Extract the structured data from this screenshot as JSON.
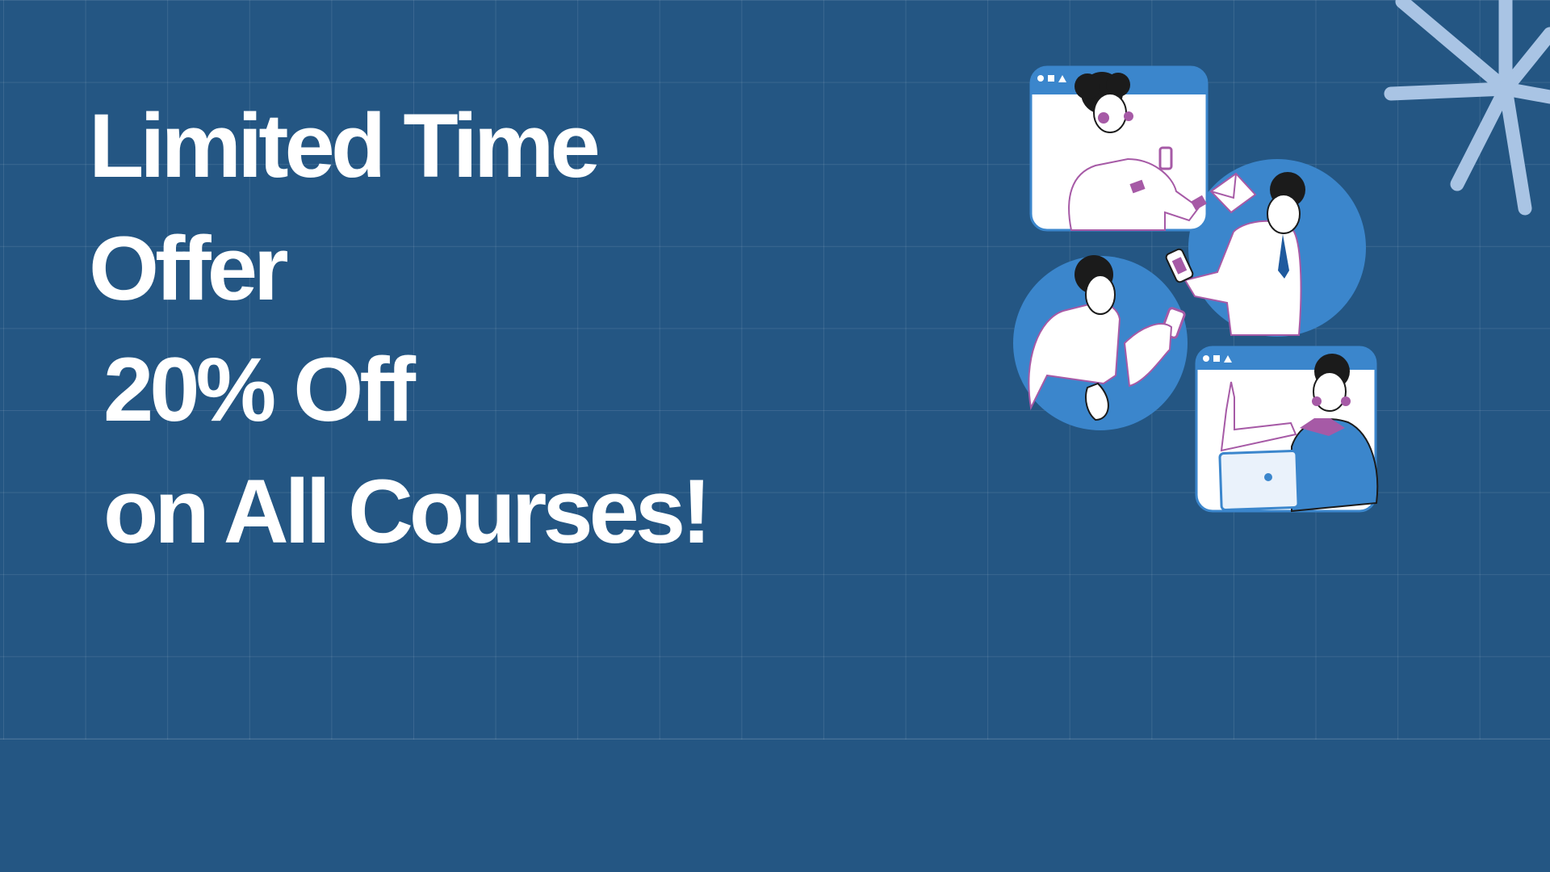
{
  "promo": {
    "line1": "Limited Time",
    "line2": "Offer",
    "line3": "20% Off",
    "line4": "on All Courses!"
  },
  "colors": {
    "background": "#245683",
    "text": "#ffffff",
    "accent_blue": "#3b86cc",
    "accent_purple": "#a65aa6",
    "star": "#a9c4e4"
  },
  "icons": [
    "online-team-illustration",
    "sparkle-star-decoration"
  ]
}
